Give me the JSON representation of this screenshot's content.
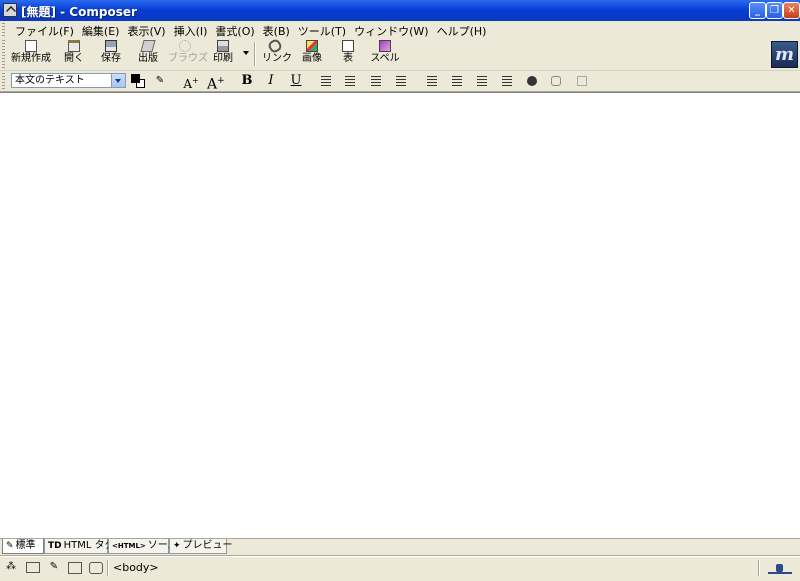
{
  "window": {
    "title": "[無題] - Composer",
    "minimize": "_",
    "maximize": "❐",
    "close": "✕"
  },
  "menu": {
    "items": [
      {
        "label": "ファイル(F)"
      },
      {
        "label": "編集(E)"
      },
      {
        "label": "表示(V)"
      },
      {
        "label": "挿入(I)"
      },
      {
        "label": "書式(O)"
      },
      {
        "label": "表(B)"
      },
      {
        "label": "ツール(T)"
      },
      {
        "label": "ウィンドウ(W)"
      },
      {
        "label": "ヘルプ(H)"
      }
    ]
  },
  "toolbar": {
    "new": "新規作成",
    "open": "開く",
    "save": "保存",
    "publish": "出版",
    "browse": "ブラウズ",
    "print": "印刷",
    "link": "リンク",
    "image": "画像",
    "table": "表",
    "spell": "スペル",
    "throbber": "m"
  },
  "format": {
    "paragraph": "本文のテキスト",
    "bold": "B",
    "italic": "I",
    "underline": "U",
    "text_color": "#000000",
    "bg_color": "#ffffff"
  },
  "tabs": {
    "normal": "標準",
    "html_tags": "HTML タグ",
    "source": "ソース",
    "preview": "プレビュー",
    "html_tags_icon": "TD",
    "source_icon": "<HTML>"
  },
  "status": {
    "element": "<body>"
  },
  "colors": {
    "titlebar": "#0a3fd4",
    "chrome": "#ece9d8"
  }
}
